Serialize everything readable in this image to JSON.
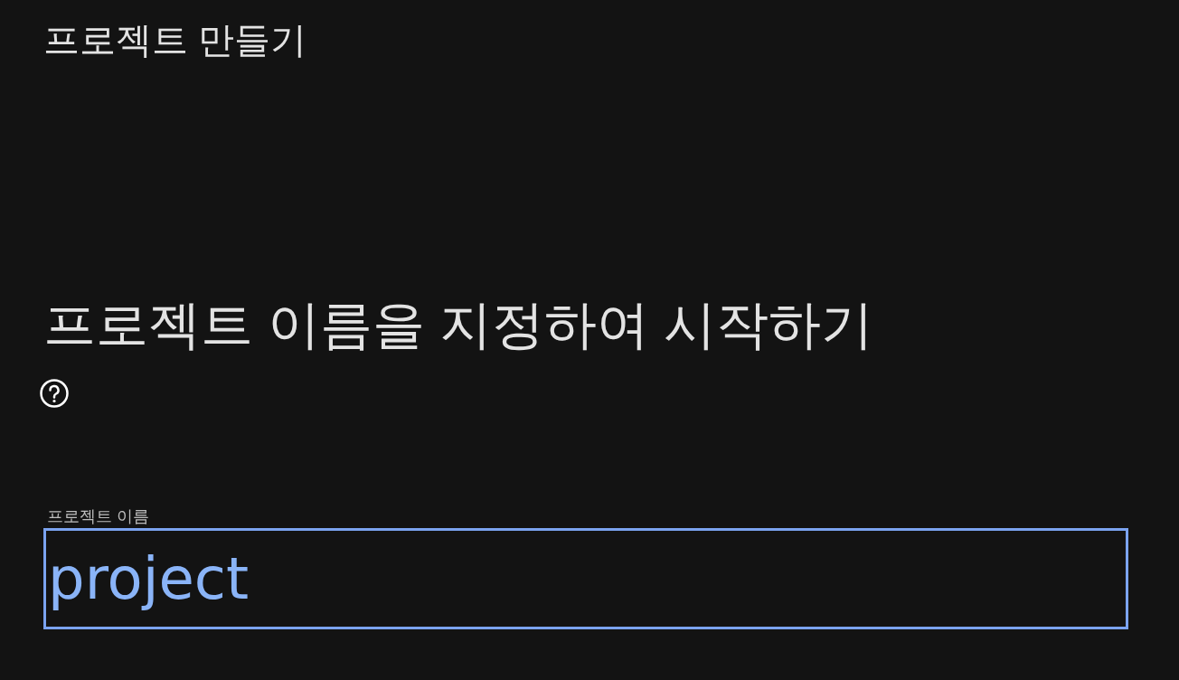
{
  "window": {
    "title": "프로젝트 만들기"
  },
  "heading": "프로젝트 이름을 지정하여 시작하기",
  "project_name_field": {
    "label": "프로젝트 이름",
    "value": "project",
    "focused": true
  }
}
